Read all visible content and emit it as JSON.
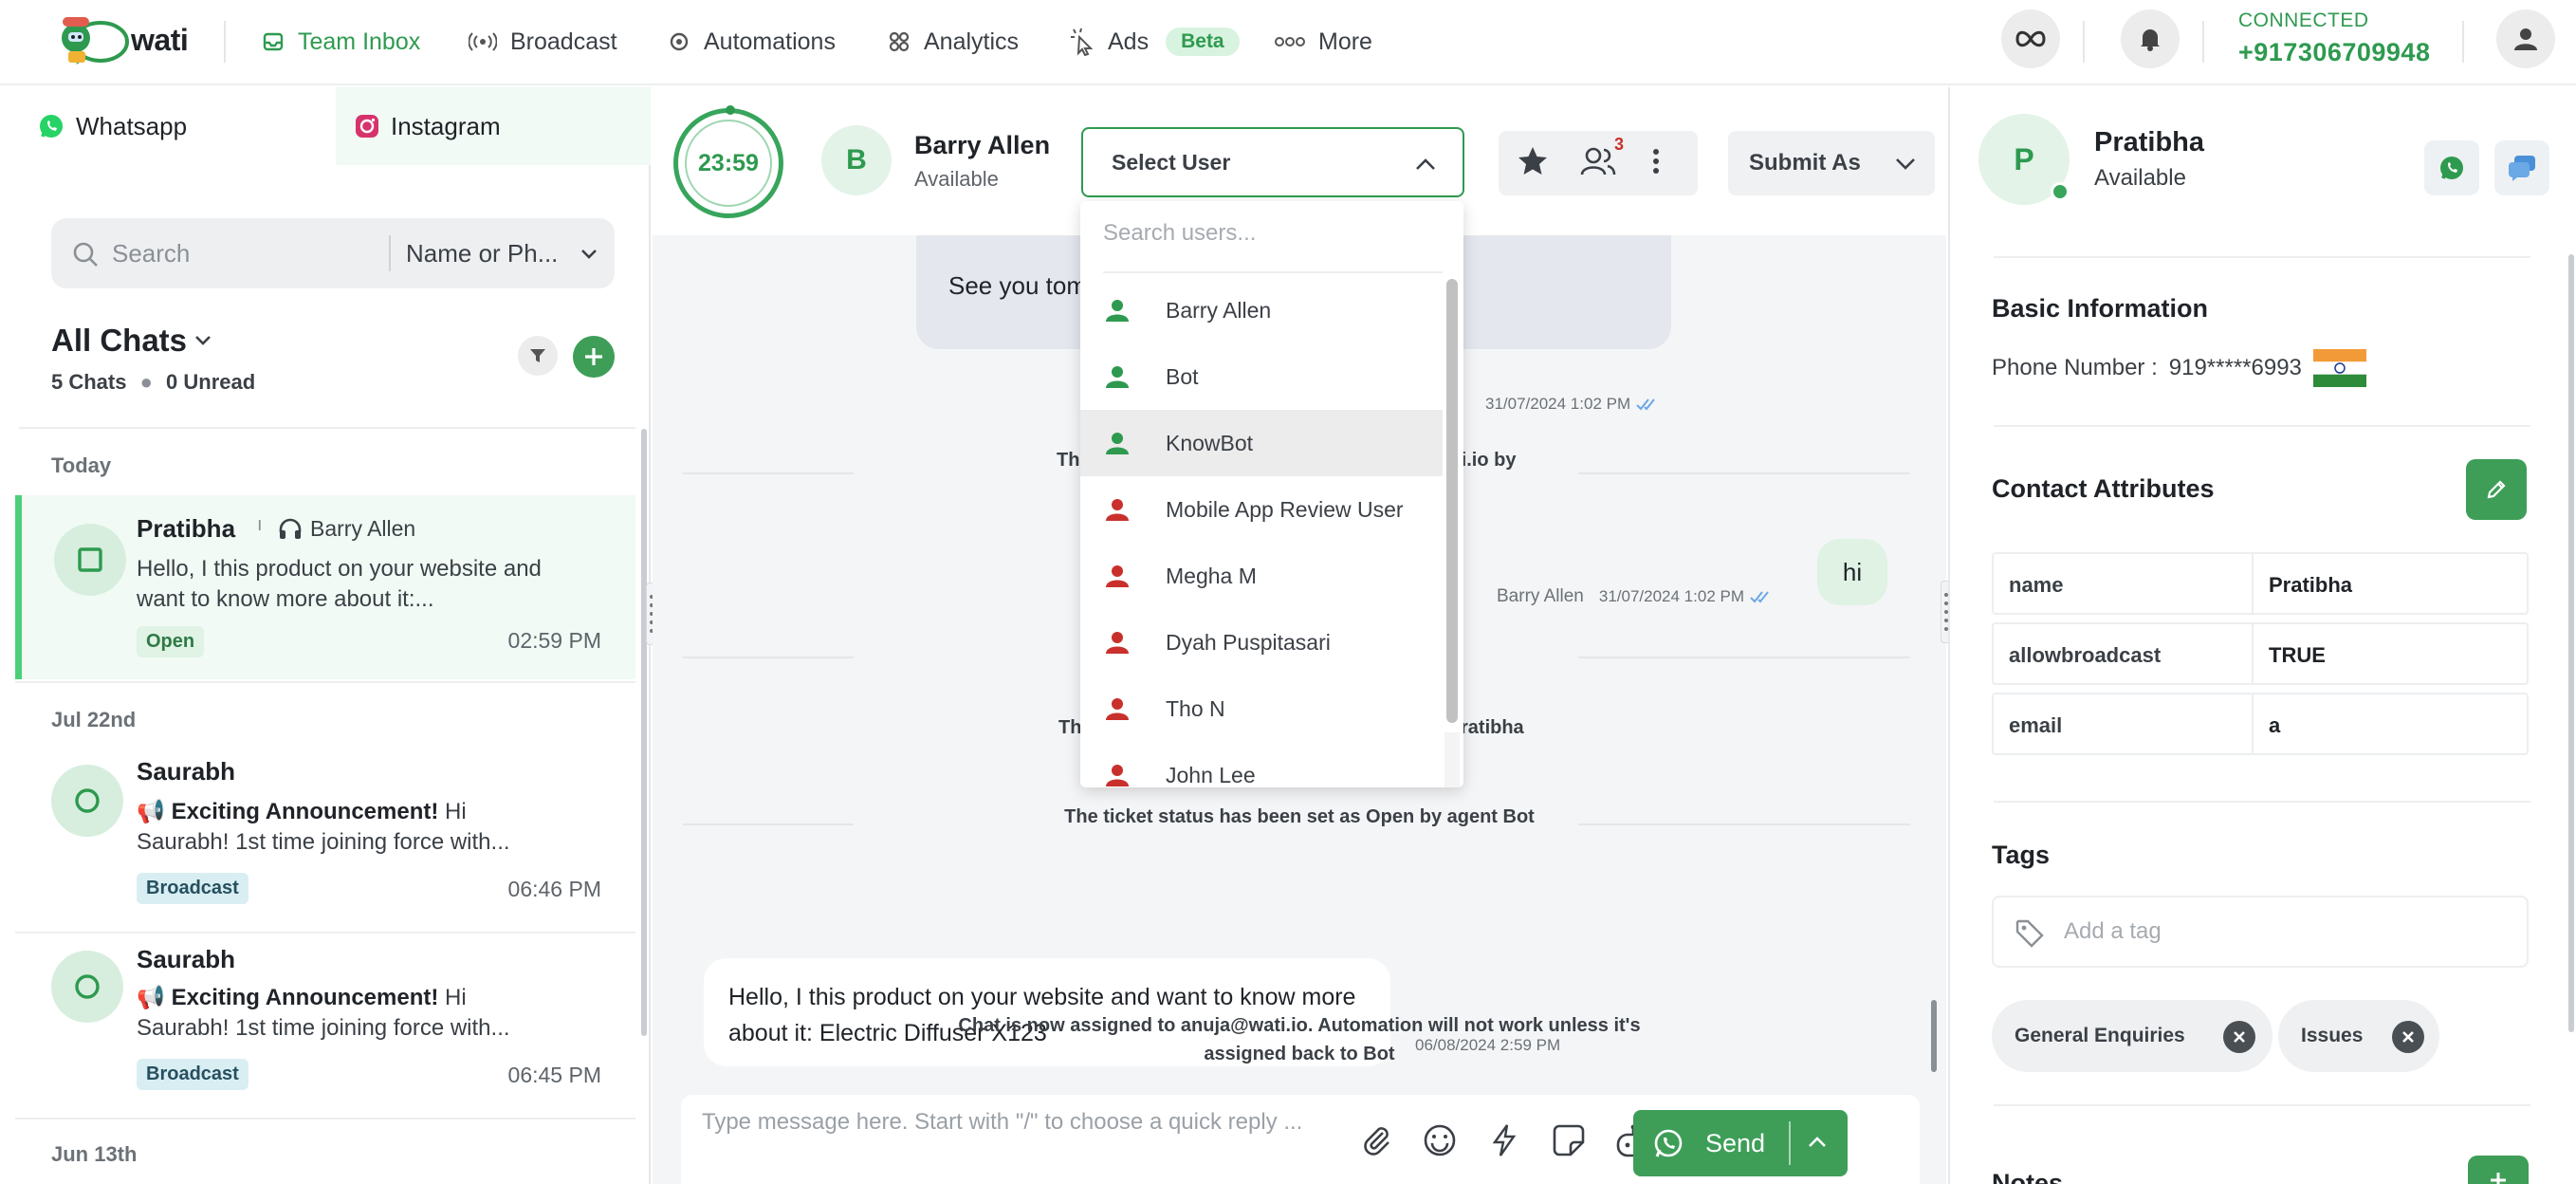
{
  "colors": {
    "brand_green": "#2e9a4f",
    "button_green": "#3e9e58",
    "tick_blue": "#6aa8e6",
    "user_red": "#c9302c"
  },
  "nav": {
    "logo": "wati",
    "items": [
      {
        "label": "Team Inbox",
        "icon": "inbox-icon",
        "active": true
      },
      {
        "label": "Broadcast",
        "icon": "broadcast-icon"
      },
      {
        "label": "Automations",
        "icon": "gear-icon"
      },
      {
        "label": "Analytics",
        "icon": "grid-icon"
      },
      {
        "label": "Ads",
        "icon": "cursor-click-icon",
        "badge": "Beta"
      },
      {
        "label": "More",
        "icon": "dots-icon"
      }
    ],
    "connection_status": "CONNECTED",
    "phone": "+917306709948"
  },
  "left": {
    "tabs": [
      "Whatsapp",
      "Instagram"
    ],
    "search": {
      "placeholder": "Search",
      "filter_label": "Name or Ph..."
    },
    "title": "All Chats",
    "meta": {
      "chats": "5 Chats",
      "unread": "0 Unread"
    },
    "sections": [
      "Today",
      "Jul 22nd",
      "Jun 13th"
    ],
    "chats": [
      {
        "name": "Pratibha",
        "agent": "Barry Allen",
        "preview": "Hello, I this product on your website and want to know more about it:...",
        "badge": "Open",
        "time": "02:59 PM"
      },
      {
        "name": "Saurabh",
        "preview_bold": "Exciting Announcement!",
        "preview": " Hi Saurabh! 1st time joining force with...",
        "badge": "Broadcast",
        "time": "06:46 PM"
      },
      {
        "name": "Saurabh",
        "preview_bold": "Exciting Announcement!",
        "preview": " Hi Saurabh! 1st time joining force with...",
        "badge": "Broadcast",
        "time": "06:45 PM"
      }
    ]
  },
  "chat": {
    "timer": "23:59",
    "contact_initial": "B",
    "contact_name": "Barry Allen",
    "contact_status": "Available",
    "select_user": "Select User",
    "notification_count": "3",
    "submit_label": "Submit As",
    "msg1_partial": "See you tom",
    "msg1_meta": "31/07/2024 1:02 PM",
    "sys1_left": "Th",
    "sys1_right": "ti.io by",
    "msg_hi": "hi",
    "msg_hi_sender": "Barry Allen",
    "msg_hi_meta": "31/07/2024 1:02 PM",
    "sys2_left": "Th",
    "sys2_right": "ratibha",
    "sys3": "The ticket status has been set as Open by agent Bot",
    "msg_customer": "Hello, I this product on your website and want to know more about it: Electric Diffuser X123",
    "msg_customer_meta": "06/08/2024 2:59 PM",
    "sys4": "Chat is now assigned to anuja@wati.io. Automation will not work unless it's assigned back to Bot",
    "composer_placeholder": "Type message here. Start with \"/\" to choose a quick reply ...",
    "send_label": "Send"
  },
  "dropdown": {
    "search_placeholder": "Search users...",
    "users": [
      {
        "name": "Barry Allen",
        "status": "online"
      },
      {
        "name": "Bot",
        "status": "online"
      },
      {
        "name": "KnowBot",
        "status": "online"
      },
      {
        "name": "Mobile App Review User",
        "status": "offline"
      },
      {
        "name": "Megha M",
        "status": "offline"
      },
      {
        "name": "Dyah Puspitasari",
        "status": "offline"
      },
      {
        "name": "Tho N",
        "status": "offline"
      },
      {
        "name": "John Lee",
        "status": "offline"
      }
    ]
  },
  "right": {
    "initial": "P",
    "name": "Pratibha",
    "status": "Available",
    "basic_info_title": "Basic Information",
    "phone_label": "Phone Number :",
    "phone_value": "919*****6993",
    "attributes_title": "Contact Attributes",
    "attributes": [
      {
        "key": "name",
        "value": "Pratibha"
      },
      {
        "key": "allowbroadcast",
        "value": "TRUE"
      },
      {
        "key": "email",
        "value": "a"
      }
    ],
    "tags_title": "Tags",
    "tag_placeholder": "Add a tag",
    "tags": [
      "General Enquiries",
      "Issues"
    ],
    "notes_title": "Notes"
  }
}
